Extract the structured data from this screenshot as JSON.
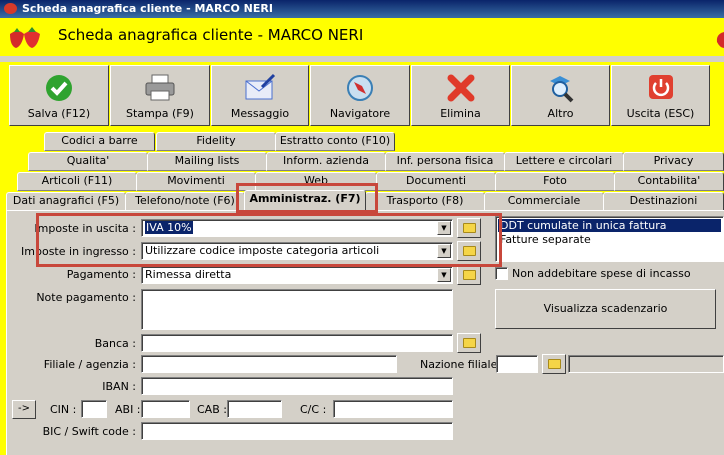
{
  "window": {
    "title": "Scheda anagrafica cliente - MARCO NERI"
  },
  "header": {
    "title": "Scheda anagrafica cliente - MARCO NERI",
    "logo_icon": "strawberry-icon"
  },
  "toolbar": {
    "buttons": [
      {
        "label": "Salva (F12)",
        "icon": "check-icon",
        "color": "#2fa32f"
      },
      {
        "label": "Stampa (F9)",
        "icon": "printer-icon",
        "color": "#707070"
      },
      {
        "label": "Messaggio",
        "icon": "envelope-icon",
        "color": "#4a6fd0"
      },
      {
        "label": "Navigatore",
        "icon": "compass-icon",
        "color": "#3a7fb5"
      },
      {
        "label": "Elimina",
        "icon": "x-icon",
        "color": "#e03a2a"
      },
      {
        "label": "Altro",
        "icon": "magnifier-icon",
        "color": "#3a8fd5"
      },
      {
        "label": "Uscita (ESC)",
        "icon": "power-icon",
        "color": "#e04030"
      }
    ]
  },
  "tabs": {
    "row1": [
      "Codici a barre",
      "Fidelity",
      "Estratto conto (F10)"
    ],
    "row2": [
      "Qualita'",
      "Mailing lists",
      "Inform. azienda",
      "Inf. persona fisica",
      "Lettere e circolari",
      "Privacy"
    ],
    "row3": [
      "Articoli (F11)",
      "Movimenti",
      "Web",
      "Documenti",
      "Foto",
      "Contabilita'"
    ],
    "row4": [
      "Dati anagrafici (F5)",
      "Telefono/note (F6)",
      "Amministraz. (F7)",
      "Trasporto (F8)",
      "Commerciale",
      "Destinazioni"
    ]
  },
  "form": {
    "imposte_uscita_label": "Imposte in uscita :",
    "imposte_uscita_value": "IVA 10%",
    "imposte_ingresso_label": "Imposte in ingresso :",
    "imposte_ingresso_value": "Utilizzare codice imposte categoria articoli",
    "pagamento_label": "Pagamento :",
    "pagamento_value": "Rimessa diretta",
    "note_pagamento_label": "Note pagamento :",
    "banca_label": "Banca :",
    "filiale_label": "Filiale / agenzia :",
    "nazione_filiale_label": "Nazione filiale :",
    "iban_label": "IBAN :",
    "arrow_button": "->",
    "cin_label": "CIN :",
    "abi_label": "ABI :",
    "cab_label": "CAB :",
    "cc_label": "C/C :",
    "bic_label": "BIC / Swift code :"
  },
  "ddt_list": {
    "items": [
      "DDT cumulate in unica fattura",
      "Fatture separate"
    ],
    "selected_index": 0
  },
  "checkbox": {
    "label": "Non addebitare spese di incasso",
    "checked": false
  },
  "scadenzario_button": "Visualizza scadenzario",
  "colors": {
    "header_bg": "#ffff00",
    "highlight": "#c8473b",
    "selection": "#0a246a"
  }
}
